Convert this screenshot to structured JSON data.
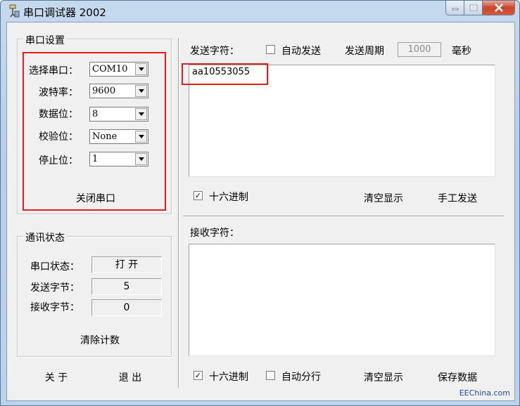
{
  "window": {
    "title": "串口调试器 2002"
  },
  "port_settings": {
    "group_title": "串口设置",
    "rows": [
      {
        "label": "选择串口：",
        "value": "COM10"
      },
      {
        "label": "波特率：",
        "value": "9600"
      },
      {
        "label": "数据位：",
        "value": "8"
      },
      {
        "label": "校验位：",
        "value": "None"
      },
      {
        "label": "停止位：",
        "value": "1"
      }
    ],
    "close_port_label": "关闭串口"
  },
  "comm_status": {
    "group_title": "通讯状态",
    "port_status_label": "串口状态：",
    "port_status_value": "打 开",
    "sent_bytes_label": "发送字节：",
    "sent_bytes_value": "5",
    "recv_bytes_label": "接收字节：",
    "recv_bytes_value": "0",
    "clear_count_label": "清除计数"
  },
  "bottom_buttons": {
    "about_label": "关 于",
    "exit_label": "退 出"
  },
  "send": {
    "title": "发送字符：",
    "auto_send_label": "自动发送",
    "period_label": "发送周期",
    "period_value": "1000",
    "period_unit": "毫秒",
    "text": "aa10553055",
    "hex_label": "十六进制",
    "hex_checked": true,
    "clear_label": "清空显示",
    "manual_send_label": "手工发送"
  },
  "receive": {
    "title": "接收字符：",
    "text": "",
    "hex_label": "十六进制",
    "hex_checked": true,
    "auto_newline_label": "自动分行",
    "clear_label": "清空显示",
    "save_label": "保存数据"
  },
  "watermark": "EEChina.com",
  "colors": {
    "highlight": "#e02020"
  }
}
